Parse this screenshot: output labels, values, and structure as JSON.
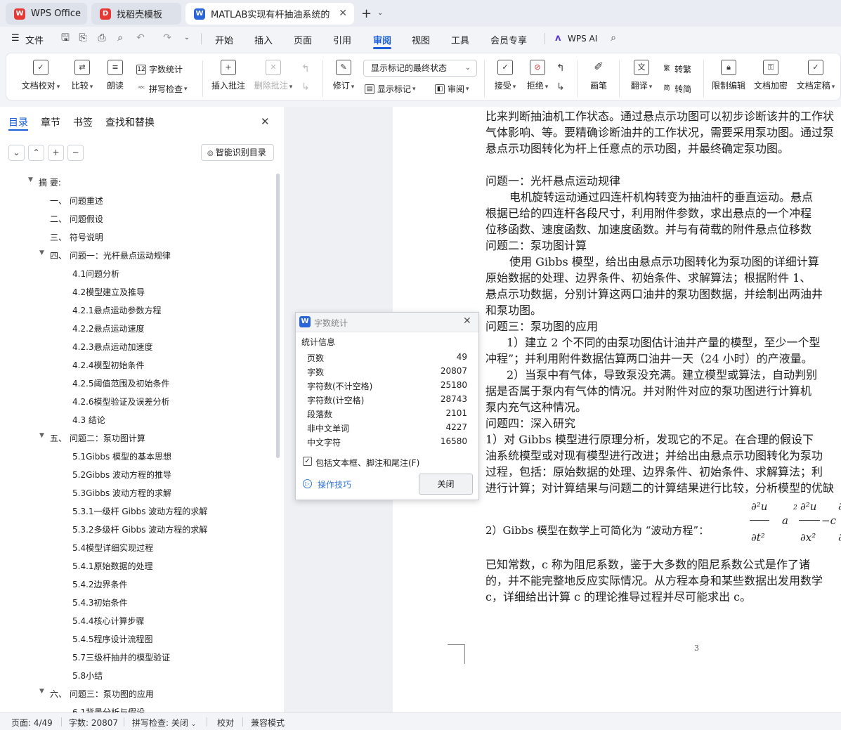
{
  "tabs": [
    {
      "label": "WPS Office",
      "icon": "wps-logo-icon"
    },
    {
      "label": "找稻壳模板",
      "icon": "docer-icon"
    },
    {
      "label": "MATLAB实现有杆抽油系统的",
      "icon": "word-doc-icon"
    }
  ],
  "menu": {
    "file": "文件",
    "items": [
      "开始",
      "插入",
      "页面",
      "引用",
      "审阅",
      "视图",
      "工具",
      "会员专享"
    ],
    "active": "审阅",
    "ai": "WPS AI"
  },
  "ribbon": {
    "doc_check": "文档校对",
    "compare": "比较",
    "read_aloud": "朗读",
    "word_count": "字数统计",
    "spell_check": "拼写检查",
    "insert_comment": "插入批注",
    "delete_comment": "删除批注",
    "revise": "修订",
    "markup_dropdown": "显示标记的最终状态",
    "show_markup": "显示标记",
    "review": "审阅",
    "accept": "接受",
    "reject": "拒绝",
    "pen": "画笔",
    "translate": "翻译",
    "to_traditional": "转繁",
    "to_simplified": "转简",
    "restrict_edit": "限制编辑",
    "encrypt": "文档加密",
    "finalize": "文档定稿"
  },
  "sidebar": {
    "tabs": [
      "目录",
      "章节",
      "书签",
      "查找和替换"
    ],
    "active_tab": "目录",
    "smart_toc": "智能识别目录",
    "toc": [
      {
        "text": "摘  要:",
        "level": 0,
        "expand": true
      },
      {
        "text": "一、  问题重述",
        "level": 1
      },
      {
        "text": "二、  问题假设",
        "level": 1
      },
      {
        "text": "三、  符号说明",
        "level": 1
      },
      {
        "text": "四、  问题一：光杆悬点运动规律",
        "level": 1,
        "expand": true
      },
      {
        "text": "4.1问题分析",
        "level": 2
      },
      {
        "text": "4.2模型建立及推导",
        "level": 2
      },
      {
        "text": "4.2.1悬点运动参数方程",
        "level": 2
      },
      {
        "text": "4.2.2悬点运动速度",
        "level": 2
      },
      {
        "text": "4.2.3悬点运动加速度",
        "level": 2
      },
      {
        "text": "4.2.4模型初始条件",
        "level": 2
      },
      {
        "text": "4.2.5阈值范围及初始条件",
        "level": 2
      },
      {
        "text": "4.2.6模型验证及误差分析",
        "level": 2
      },
      {
        "text": "4.3 结论",
        "level": 2
      },
      {
        "text": "五、  问题二：泵功图计算",
        "level": 1,
        "expand": true
      },
      {
        "text": "5.1Gibbs 模型的基本思想",
        "level": 2
      },
      {
        "text": "5.2Gibbs 波动方程的推导",
        "level": 2
      },
      {
        "text": "5.3Gibbs 波动方程的求解",
        "level": 2
      },
      {
        "text": "5.3.1一级杆 Gibbs 波动方程的求解",
        "level": 2
      },
      {
        "text": "5.3.2多级杆 Gibbs 波动方程的求解",
        "level": 2
      },
      {
        "text": "5.4模型详细实现过程",
        "level": 2
      },
      {
        "text": "5.4.1原始数据的处理",
        "level": 2
      },
      {
        "text": "5.4.2边界条件",
        "level": 2
      },
      {
        "text": "5.4.3初始条件",
        "level": 2
      },
      {
        "text": "5.4.4核心计算步骤",
        "level": 2
      },
      {
        "text": "5.4.5程序设计流程图",
        "level": 2
      },
      {
        "text": "5.7三级杆抽井的模型验证",
        "level": 2
      },
      {
        "text": "5.8小结",
        "level": 2
      },
      {
        "text": "六、  问题三：泵功图的应用",
        "level": 1,
        "expand": true
      },
      {
        "text": "6.1背景分析与假设",
        "level": 2
      }
    ]
  },
  "document": {
    "lines": [
      "比来判断抽油机工作状态。通过悬点示功图可以初步诊断该井的工作状",
      "气体影响、等。要精确诊断油井的工作状况，需要采用泵功图。通过泵",
      "悬点示功图转化为杆上任意点的示功图，并最终确定泵功图。",
      "问题一：光杆悬点运动规律",
      "电机旋转运动通过四连杆机构转变为抽油杆的垂直运动。悬点",
      "根据已给的四连杆各段尺寸，利用附件参数，求出悬点的一个冲程",
      "位移函数、速度函数、加速度函数。并与有荷载的附件悬点位移数",
      "问题二：泵功图计算",
      "使用 Gibbs 模型，给出由悬点示功图转化为泵功图的详细计算",
      "原始数据的处理、边界条件、初始条件、求解算法；根据附件 1、",
      "悬点示功数据，分别计算这两口油井的泵功图数据，并绘制出两油井",
      "和泵功图。",
      "问题三：泵功图的应用",
      "1）建立 2 个不同的由泵功图估计油井产量的模型，至少一个型",
      "冲程”；并利用附件数据估算两口油井一天（24 小时）的产液量。",
      "2）当泵中有气体，导致泵没充满。建立模型或算法，自动判别",
      "据是否属于泵内有气体的情况。并对附件对应的泵功图进行计算机",
      "泵内充气这种情况。",
      "问题四：深入研究",
      "1）对 Gibbs 模型进行原理分析，发现它的不足。在合理的假设下",
      "油系统模型或对现有模型进行改进；并给出由悬点示功图转化为泵功",
      "过程，包括：原始数据的处理、边界条件、初始条件、求解算法；利",
      "进行计算；对计算结果与问题二的计算结果进行比较，分析模型的优缺",
      "2）Gibbs 模型在数学上可简化为 “波动方程”：",
      "已知常数，c 称为阻尼系数，鉴于大多数的阻尼系数公式是作了诸",
      "的，并不能完整地反应实际情况。从方程本身和某些数据出发用数学",
      "c，详细给出计算 c 的理论推导过程并尽可能求出 c。"
    ],
    "page_number": "3"
  },
  "word_count_dialog": {
    "title": "字数统计",
    "section": "统计信息",
    "rows": [
      {
        "label": "页数",
        "value": "49"
      },
      {
        "label": "字数",
        "value": "20807"
      },
      {
        "label": "字符数(不计空格)",
        "value": "25180"
      },
      {
        "label": "字符数(计空格)",
        "value": "28743"
      },
      {
        "label": "段落数",
        "value": "2101"
      },
      {
        "label": "非中文单词",
        "value": "4227"
      },
      {
        "label": "中文字符",
        "value": "16580"
      }
    ],
    "checkbox": "包括文本框、脚注和尾注(F)",
    "tips": "操作技巧",
    "close": "关闭"
  },
  "status": {
    "page": "页面: 4/49",
    "words": "字数: 20807",
    "spell": "拼写检查: 关闭",
    "proof": "校对",
    "compat": "兼容模式"
  }
}
